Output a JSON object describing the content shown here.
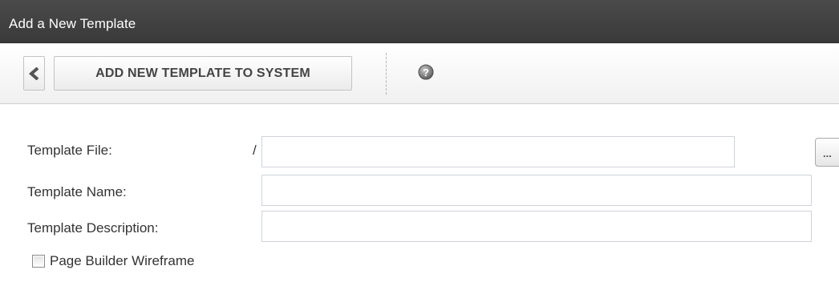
{
  "window": {
    "title": "Add a New Template"
  },
  "toolbar": {
    "back_icon": "chevron-left-icon",
    "add_button_label": "ADD NEW TEMPLATE TO SYSTEM",
    "help_icon": "help-icon"
  },
  "form": {
    "template_file": {
      "label": "Template File:",
      "prefix": "/",
      "value": "",
      "browse_label": "..."
    },
    "template_name": {
      "label": "Template Name:",
      "value": ""
    },
    "template_description": {
      "label": "Template Description:",
      "value": ""
    },
    "page_builder": {
      "label": "Page Builder Wireframe",
      "checked": false
    }
  },
  "colors": {
    "titlebar": "#404040",
    "toolbar": "#f5f5f5",
    "text": "#333333",
    "field_border": "#cfd4da"
  }
}
